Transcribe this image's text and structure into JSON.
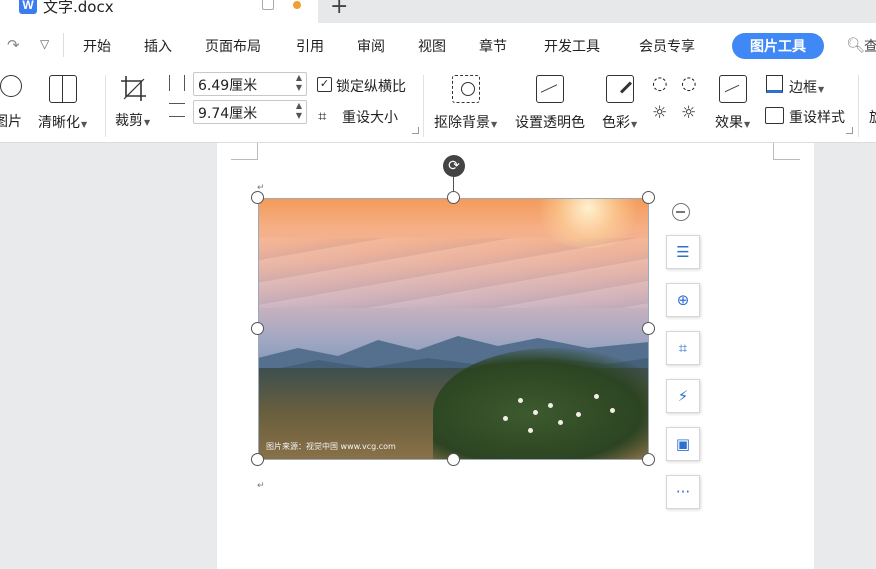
{
  "titlebar": {
    "doc_icon": "W",
    "doc_title": "文字.docx",
    "new_tab": "+"
  },
  "ribbon_tabs": {
    "items": [
      "开始",
      "插入",
      "页面布局",
      "引用",
      "审阅",
      "视图",
      "章节",
      "开发工具",
      "会员专享"
    ],
    "active": "图片工具",
    "search_partial": "查"
  },
  "toolbar": {
    "picture": "图片",
    "sharpen": "清晰化",
    "crop": "裁剪",
    "height_value": "6.49厘米",
    "width_value": "9.74厘米",
    "lock_ratio": "锁定纵横比",
    "lock_checked": true,
    "reset_size": "重设大小",
    "remove_bg": "抠除背景",
    "set_transparent": "设置透明色",
    "color": "色彩",
    "effects": "效果",
    "border": "边框",
    "reset_style": "重设样式",
    "cut_partial": "旋"
  },
  "document": {
    "image_credit": "图片来源：视觉中国 www.vcg.com"
  },
  "colors": {
    "accent": "#3f88f5",
    "doc_icon": "#3c7cf2",
    "unsaved_dot": "#f0a030"
  },
  "side_toolbar": [
    "wrap-text-icon",
    "zoom-in-icon",
    "crop-icon",
    "smart-icon",
    "image-to-doc-icon",
    "more-icon"
  ]
}
